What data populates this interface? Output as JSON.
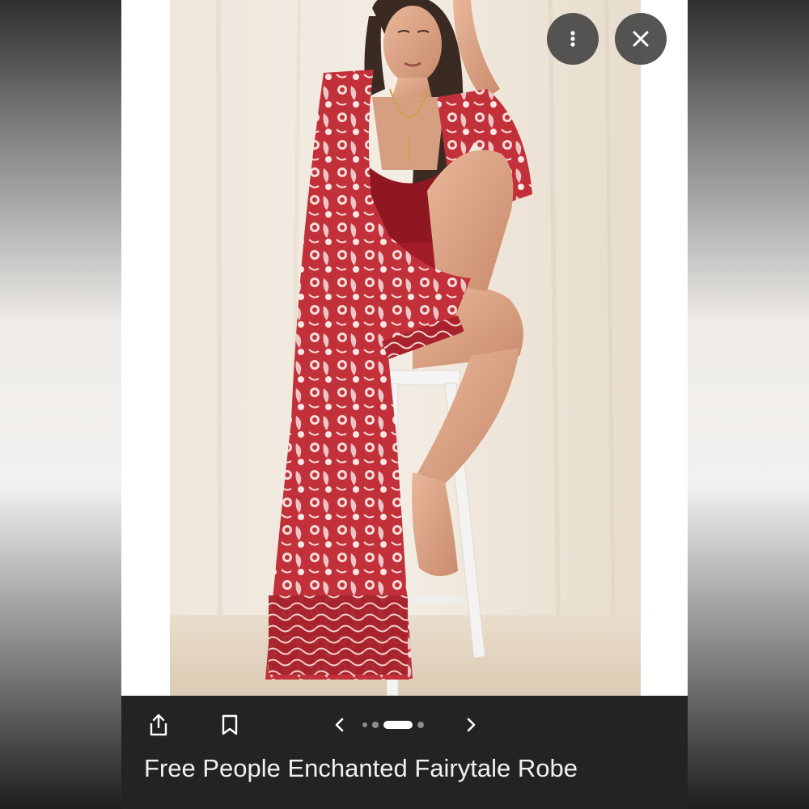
{
  "viewer": {
    "more_icon": "more-vert-icon",
    "close_icon": "close-icon"
  },
  "photo": {
    "subject": "photo"
  },
  "toolbar": {
    "share_icon": "share-icon",
    "save_icon": "bookmark-icon",
    "prev_icon": "chevron-left-icon",
    "next_icon": "chevron-right-icon",
    "pager": {
      "total": 4,
      "active_index": 2
    }
  },
  "caption": {
    "title": "Free People Enchanted Fairytale Robe"
  },
  "colors": {
    "bar_background": "#232323",
    "robe_red": "#b8282e",
    "backdrop": "#ece3d6"
  }
}
